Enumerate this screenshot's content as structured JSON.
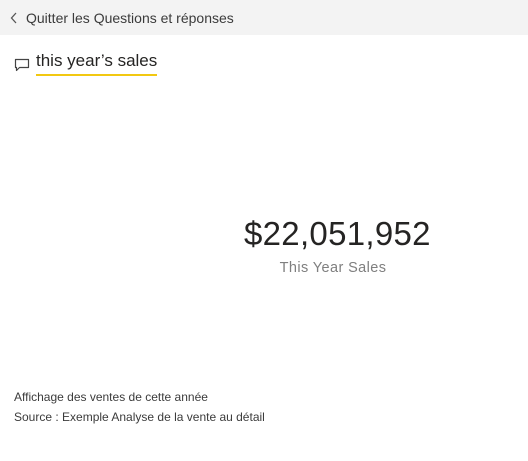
{
  "topbar": {
    "back_label": "Quitter les Questions et réponses",
    "back_icon": "chevron-left-icon"
  },
  "qa": {
    "icon": "chat-bubble-icon",
    "query_text": "this year’s sales",
    "underline_color": "#f2c811"
  },
  "card": {
    "value": "$22,051,952",
    "label": "This Year Sales"
  },
  "footer": {
    "showing": "Affichage des ventes de cette année",
    "source": "Source : Exemple Analyse de la vente au détail"
  }
}
